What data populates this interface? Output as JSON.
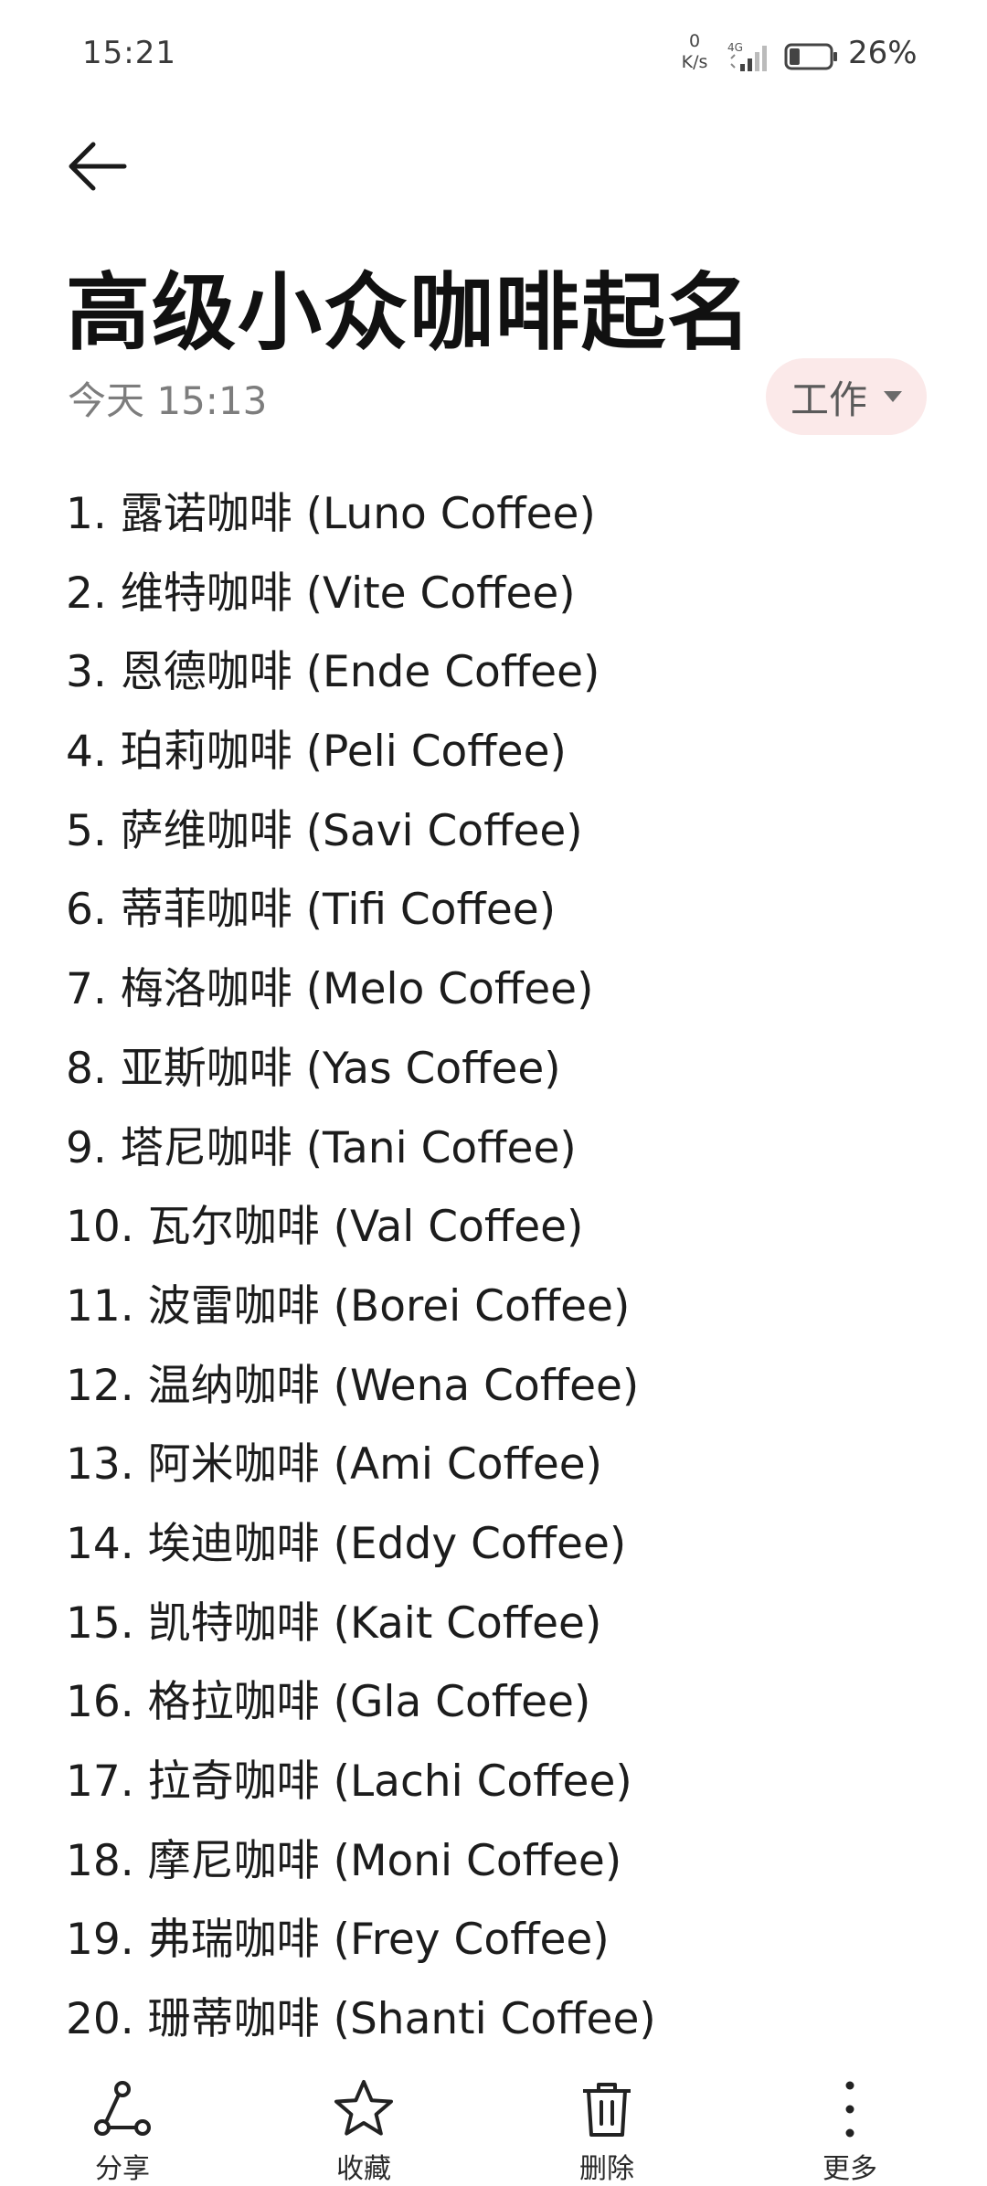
{
  "status_bar": {
    "time": "15:21",
    "net_speed_value": "0",
    "net_speed_unit": "K/s",
    "network_type": "4G",
    "battery_percent": "26%",
    "battery_level": 0.26
  },
  "header": {
    "back_icon": "arrow-left-icon",
    "title": "高级小众咖啡起名",
    "date": "今天 15:13",
    "category": "工作",
    "category_color": "#fbe9e9"
  },
  "note": {
    "lines": [
      "1. 露诺咖啡 (Luno Coffee)",
      "2. 维特咖啡 (Vite Coffee)",
      "3. 恩德咖啡 (Ende Coffee)",
      "4. 珀莉咖啡 (Peli Coffee)",
      "5. 萨维咖啡 (Savi Coffee)",
      "6. 蒂菲咖啡 (Tifi Coffee)",
      "7. 梅洛咖啡 (Melo Coffee)",
      "8. 亚斯咖啡 (Yas Coffee)",
      "9. 塔尼咖啡 (Tani Coffee)",
      "10. 瓦尔咖啡 (Val Coffee)",
      "11. 波雷咖啡 (Borei Coffee)",
      "12. 温纳咖啡 (Wena Coffee)",
      "13. 阿米咖啡 (Ami Coffee)",
      "14. 埃迪咖啡 (Eddy Coffee)",
      "15. 凯特咖啡 (Kait Coffee)",
      "16. 格拉咖啡 (Gla Coffee)",
      "17. 拉奇咖啡 (Lachi Coffee)",
      "18. 摩尼咖啡 (Moni Coffee)",
      "19. 弗瑞咖啡 (Frey Coffee)",
      "20. 珊蒂咖啡 (Shanti Coffee)"
    ]
  },
  "toolbar": {
    "share_label": "分享",
    "share_icon": "share-icon",
    "favorite_label": "收藏",
    "favorite_icon": "star-icon",
    "delete_label": "删除",
    "delete_icon": "trash-icon",
    "more_label": "更多",
    "more_icon": "more-vertical-icon"
  }
}
